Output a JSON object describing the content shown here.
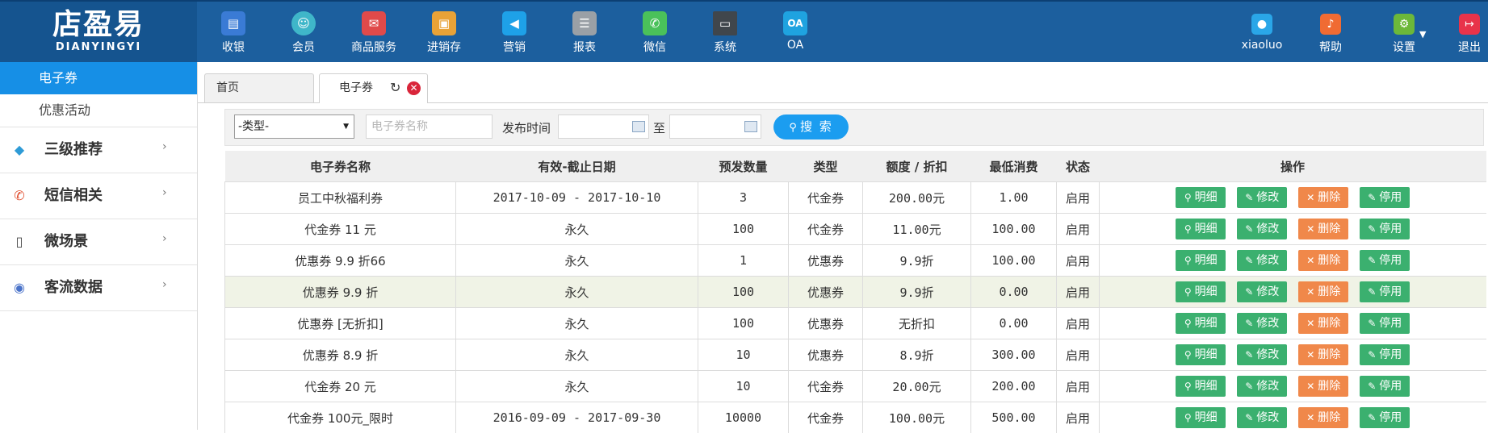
{
  "logo": {
    "cn": "店盈易",
    "en": "DIANYINGYI"
  },
  "topnav": [
    {
      "label": "收银",
      "icon": "cash-register-icon",
      "color": "#3a7bd5"
    },
    {
      "label": "会员",
      "icon": "member-icon",
      "color": "#3fb6c9"
    },
    {
      "label": "商品服务",
      "icon": "product-service-icon",
      "color": "#e04a4a"
    },
    {
      "label": "进销存",
      "icon": "inventory-icon",
      "color": "#e8a237"
    },
    {
      "label": "营销",
      "icon": "megaphone-icon",
      "color": "#1ea1e8"
    },
    {
      "label": "报表",
      "icon": "report-icon",
      "color": "#9aa0a6"
    },
    {
      "label": "微信",
      "icon": "wechat-icon",
      "color": "#4ac15a"
    },
    {
      "label": "系统",
      "icon": "monitor-icon",
      "color": "#40464c"
    },
    {
      "label": "OA",
      "icon": "oa-icon",
      "color": "#1fa3e0"
    }
  ],
  "rightnav": [
    {
      "label": "xiaoluo",
      "icon": "user-icon",
      "color": "#2aa6e8"
    },
    {
      "label": "帮助",
      "icon": "help-bell-icon",
      "color": "#f06b33"
    },
    {
      "label": "设置",
      "icon": "gear-icon",
      "color": "#6cb83a"
    },
    {
      "label": "退出",
      "icon": "logout-icon",
      "color": "#e8334a"
    }
  ],
  "sidebar": {
    "subitems": [
      {
        "label": "电子券",
        "active": true
      },
      {
        "label": "优惠活动",
        "active": false
      }
    ],
    "groups": [
      {
        "label": "三级推荐",
        "icon": "layers-icon"
      },
      {
        "label": "短信相关",
        "icon": "phone-icon"
      },
      {
        "label": "微场景",
        "icon": "mobile-icon"
      },
      {
        "label": "客流数据",
        "icon": "wave-icon"
      }
    ]
  },
  "tabs": [
    {
      "label": "首页"
    },
    {
      "label": "电子券"
    }
  ],
  "filter": {
    "type_selected": "-类型-",
    "name_placeholder": "电子券名称",
    "publish_time_label": "发布时间",
    "to_label": "至",
    "search_label": "搜 索"
  },
  "table": {
    "headers": [
      "电子券名称",
      "有效-截止日期",
      "预发数量",
      "类型",
      "额度 / 折扣",
      "最低消费",
      "状态",
      "操作"
    ],
    "actions": {
      "detail": "明细",
      "edit": "修改",
      "delete": "删除",
      "disable": "停用"
    },
    "rows": [
      {
        "name": "员工中秋福利券",
        "date": "2017-10-09 - 2017-10-10",
        "qty": "3",
        "type": "代金券",
        "amount": "200.00元",
        "min": "1.00",
        "status": "启用"
      },
      {
        "name": "代金券 11 元",
        "date": "永久",
        "qty": "100",
        "type": "代金券",
        "amount": "11.00元",
        "min": "100.00",
        "status": "启用"
      },
      {
        "name": "优惠券 9.9 折66",
        "date": "永久",
        "qty": "1",
        "type": "优惠券",
        "amount": "9.9折",
        "min": "100.00",
        "status": "启用"
      },
      {
        "name": "优惠券 9.9 折",
        "date": "永久",
        "qty": "100",
        "type": "优惠券",
        "amount": "9.9折",
        "min": "0.00",
        "status": "启用"
      },
      {
        "name": "优惠券 [无折扣]",
        "date": "永久",
        "qty": "100",
        "type": "优惠券",
        "amount": "无折扣",
        "min": "0.00",
        "status": "启用"
      },
      {
        "name": "优惠券 8.9 折",
        "date": "永久",
        "qty": "10",
        "type": "优惠券",
        "amount": "8.9折",
        "min": "300.00",
        "status": "启用"
      },
      {
        "name": "代金券 20 元",
        "date": "永久",
        "qty": "10",
        "type": "代金券",
        "amount": "20.00元",
        "min": "200.00",
        "status": "启用"
      },
      {
        "name": "代金券 100元_限时",
        "date": "2016-09-09 - 2017-09-30",
        "qty": "10000",
        "type": "代金券",
        "amount": "100.00元",
        "min": "500.00",
        "status": "启用"
      }
    ]
  }
}
